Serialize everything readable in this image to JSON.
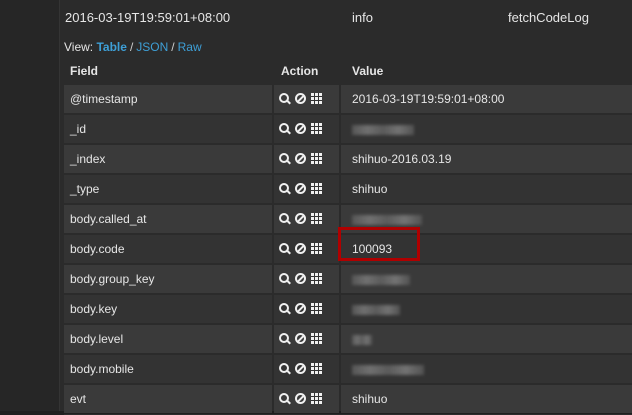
{
  "event": {
    "timestamp": "2016-03-19T19:59:01+08:00",
    "level": "info",
    "logger": "fetchCodeLog"
  },
  "view": {
    "prefix": "View:",
    "options": [
      "Table",
      "JSON",
      "Raw"
    ],
    "active": "Table",
    "separator": "/"
  },
  "columns": {
    "field": "Field",
    "action": "Action",
    "value": "Value"
  },
  "rows": [
    {
      "field": "@timestamp",
      "value": "2016-03-19T19:59:01+08:00",
      "redacted": false
    },
    {
      "field": "_id",
      "value": "",
      "redacted": true
    },
    {
      "field": "_index",
      "value": "shihuo-2016.03.19",
      "redacted": false
    },
    {
      "field": "_type",
      "value": "shihuo",
      "redacted": false
    },
    {
      "field": "body.called_at",
      "value": "",
      "redacted": true
    },
    {
      "field": "body.code",
      "value": "100093",
      "redacted": false
    },
    {
      "field": "body.group_key",
      "value": "",
      "redacted": true
    },
    {
      "field": "body.key",
      "value": "",
      "redacted": true
    },
    {
      "field": "body.level",
      "value": "",
      "redacted": true
    },
    {
      "field": "body.mobile",
      "value": "",
      "redacted": true
    },
    {
      "field": "evt",
      "value": "shihuo",
      "redacted": false
    }
  ],
  "icons": {
    "filter": "magnifier-icon",
    "exclude": "ban-icon",
    "toggle_column": "table-grid-icon"
  },
  "colors": {
    "link": "#3e9fd6",
    "highlight_border": "#b00000"
  }
}
